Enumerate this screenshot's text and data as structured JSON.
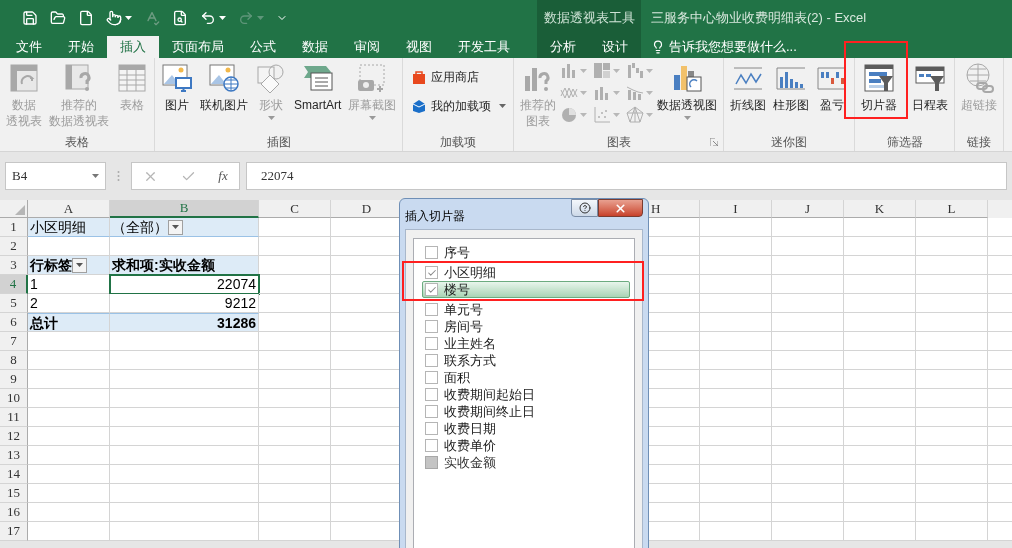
{
  "title_bar": {
    "context_group": "数据透视表工具",
    "title": "三服务中心物业收费明细表(2) - Excel"
  },
  "tabs": [
    {
      "label": "文件",
      "selected": false
    },
    {
      "label": "开始",
      "selected": false
    },
    {
      "label": "插入",
      "selected": true
    },
    {
      "label": "页面布局",
      "selected": false
    },
    {
      "label": "公式",
      "selected": false
    },
    {
      "label": "数据",
      "selected": false
    },
    {
      "label": "审阅",
      "selected": false
    },
    {
      "label": "视图",
      "selected": false
    },
    {
      "label": "开发工具",
      "selected": false
    }
  ],
  "context_tabs": [
    {
      "label": "分析",
      "selected": false
    },
    {
      "label": "设计",
      "selected": false
    }
  ],
  "tell_me": "告诉我您想要做什么...",
  "ribbon": [
    {
      "label": "表格",
      "buttons": [
        {
          "kind": "pivot-table",
          "lines": [
            "数据",
            "透视表"
          ],
          "disabled": true
        },
        {
          "kind": "recommended-pivot",
          "lines": [
            "推荐的",
            "数据透视表"
          ],
          "disabled": true
        },
        {
          "kind": "table",
          "lines": [
            "表格"
          ],
          "disabled": true
        }
      ]
    },
    {
      "label": "插图",
      "buttons": [
        {
          "kind": "picture",
          "lines": [
            "图片"
          ],
          "disabled": false
        },
        {
          "kind": "online-picture",
          "lines": [
            "联机图片"
          ],
          "disabled": false
        },
        {
          "kind": "shapes",
          "lines": [
            "形状"
          ],
          "disabled": true,
          "dropdown": true
        },
        {
          "kind": "smartart",
          "lines": [
            "SmartArt"
          ],
          "disabled": false
        },
        {
          "kind": "screenshot",
          "lines": [
            "屏幕截图"
          ],
          "disabled": true,
          "dropdown": true
        }
      ]
    },
    {
      "label": "加载项",
      "buttons": [
        {
          "kind": "store",
          "lines": [
            "应用商店"
          ],
          "disabled": false
        },
        {
          "kind": "my-addins",
          "lines": [
            "我的加载项"
          ],
          "disabled": false,
          "dropdown": true
        }
      ]
    },
    {
      "label": "图表",
      "launcher": true,
      "buttons": [
        {
          "kind": "recommended-charts",
          "lines": [
            "推荐的",
            "图表"
          ],
          "disabled": true
        },
        {
          "kind": "chart-gallery"
        },
        {
          "kind": "pivot-chart",
          "lines": [
            "数据透视图"
          ],
          "disabled": false,
          "dropdown": true
        }
      ]
    },
    {
      "label": "迷你图",
      "buttons": [
        {
          "kind": "sparkline-line",
          "lines": [
            "折线图"
          ],
          "disabled": false
        },
        {
          "kind": "sparkline-column",
          "lines": [
            "柱形图"
          ],
          "disabled": false
        },
        {
          "kind": "sparkline-winloss",
          "lines": [
            "盈亏"
          ],
          "disabled": false
        }
      ]
    },
    {
      "label": "筛选器",
      "buttons": [
        {
          "kind": "slicer",
          "lines": [
            "切片器"
          ],
          "disabled": false,
          "highlighted": true
        },
        {
          "kind": "timeline",
          "lines": [
            "日程表"
          ],
          "disabled": false
        }
      ]
    },
    {
      "label": "链接",
      "buttons": [
        {
          "kind": "hyperlink",
          "lines": [
            "超链接"
          ],
          "disabled": true
        }
      ]
    }
  ],
  "formula_bar": {
    "name_box": "B4",
    "function_button": "fx",
    "formula": "22074"
  },
  "sheet": {
    "columns": [
      {
        "label": "A",
        "selected": false
      },
      {
        "label": "B",
        "selected": true
      },
      {
        "label": "C",
        "selected": false
      },
      {
        "label": "D",
        "selected": false
      },
      {
        "label": "H",
        "selected": false
      },
      {
        "label": "I",
        "selected": false
      },
      {
        "label": "J",
        "selected": false
      },
      {
        "label": "K",
        "selected": false
      },
      {
        "label": "L",
        "selected": false
      }
    ],
    "rows": [
      {
        "label": "1",
        "selected": false,
        "kind": "page-filter",
        "cells": [
          {
            "text": "小区明细",
            "selected": false
          },
          {
            "text": "（全部）",
            "selected": false,
            "filter_button": true
          }
        ]
      },
      {
        "label": "2",
        "selected": false,
        "kind": "blank",
        "cells": []
      },
      {
        "label": "3",
        "selected": false,
        "kind": "header",
        "cells": [
          {
            "text": "行标签",
            "selected": false,
            "filter_button": true
          },
          {
            "text": "求和项:实收金额",
            "selected": false
          }
        ]
      },
      {
        "label": "4",
        "selected": true,
        "kind": "item",
        "cells": [
          {
            "text": "1",
            "selected": false
          },
          {
            "text": "22074",
            "selected": true
          }
        ]
      },
      {
        "label": "5",
        "selected": false,
        "kind": "item",
        "cells": [
          {
            "text": "2",
            "selected": false
          },
          {
            "text": "9212",
            "selected": false
          }
        ]
      },
      {
        "label": "6",
        "selected": false,
        "kind": "total",
        "cells": [
          {
            "text": "总计",
            "selected": false
          },
          {
            "text": "31286",
            "selected": false
          }
        ]
      },
      {
        "label": "7",
        "selected": false,
        "kind": "blank",
        "cells": []
      },
      {
        "label": "8",
        "selected": false,
        "kind": "blank",
        "cells": []
      },
      {
        "label": "9",
        "selected": false,
        "kind": "blank",
        "cells": []
      },
      {
        "label": "10",
        "selected": false,
        "kind": "blank",
        "cells": []
      },
      {
        "label": "11",
        "selected": false,
        "kind": "blank",
        "cells": []
      },
      {
        "label": "12",
        "selected": false,
        "kind": "blank",
        "cells": []
      },
      {
        "label": "13",
        "selected": false,
        "kind": "blank",
        "cells": []
      },
      {
        "label": "14",
        "selected": false,
        "kind": "blank",
        "cells": []
      },
      {
        "label": "15",
        "selected": false,
        "kind": "blank",
        "cells": []
      },
      {
        "label": "16",
        "selected": false,
        "kind": "blank",
        "cells": []
      },
      {
        "label": "17",
        "selected": false,
        "kind": "blank",
        "cells": []
      }
    ]
  },
  "dialog": {
    "title": "插入切片器",
    "items": [
      {
        "label": "序号",
        "checked": false,
        "disabled": false,
        "selected": false,
        "highlighted": false
      },
      {
        "label": "小区明细",
        "checked": true,
        "disabled": false,
        "selected": false,
        "highlighted": true
      },
      {
        "label": "楼号",
        "checked": true,
        "disabled": false,
        "selected": true,
        "highlighted": true
      },
      {
        "label": "单元号",
        "checked": false,
        "disabled": false,
        "selected": false,
        "highlighted": false
      },
      {
        "label": "房间号",
        "checked": false,
        "disabled": false,
        "selected": false,
        "highlighted": false
      },
      {
        "label": "业主姓名",
        "checked": false,
        "disabled": false,
        "selected": false,
        "highlighted": false
      },
      {
        "label": "联系方式",
        "checked": false,
        "disabled": false,
        "selected": false,
        "highlighted": false
      },
      {
        "label": "面积",
        "checked": false,
        "disabled": false,
        "selected": false,
        "highlighted": false
      },
      {
        "label": "收费期间起始日",
        "checked": false,
        "disabled": false,
        "selected": false,
        "highlighted": false
      },
      {
        "label": "收费期间终止日",
        "checked": false,
        "disabled": false,
        "selected": false,
        "highlighted": false
      },
      {
        "label": "收费日期",
        "checked": false,
        "disabled": false,
        "selected": false,
        "highlighted": false
      },
      {
        "label": "收费单价",
        "checked": false,
        "disabled": false,
        "selected": false,
        "highlighted": false
      },
      {
        "label": "实收金额",
        "checked": false,
        "disabled": true,
        "selected": false,
        "highlighted": false
      }
    ]
  }
}
